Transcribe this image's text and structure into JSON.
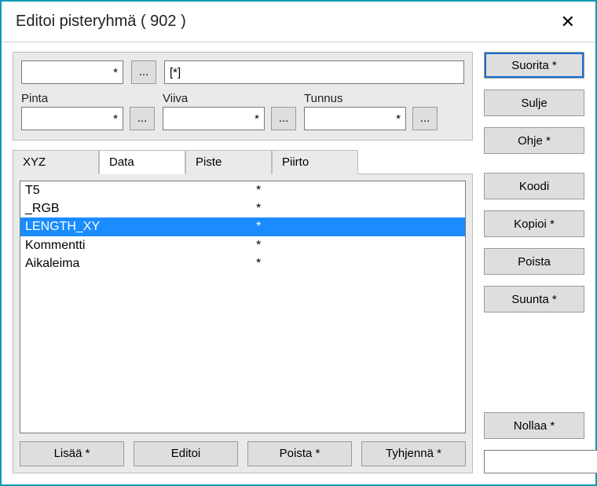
{
  "title": "Editoi pisteryhmä  ( 902 )",
  "top": {
    "field1": {
      "value": "*"
    },
    "browse1": "...",
    "field2": {
      "value": "[*]"
    },
    "pinta": {
      "label": "Pinta",
      "value": "*"
    },
    "browse_pinta": "...",
    "viiva": {
      "label": "Viiva",
      "value": "*"
    },
    "browse_viiva": "...",
    "tunnus": {
      "label": "Tunnus",
      "value": "*"
    },
    "browse_tunnus": "..."
  },
  "tabs": {
    "xyz": "XYZ",
    "data": "Data",
    "piste": "Piste",
    "piirto": "Piirto",
    "active": "data"
  },
  "list": [
    {
      "name": "T5",
      "value": "*",
      "selected": false
    },
    {
      "name": "_RGB",
      "value": "*",
      "selected": false
    },
    {
      "name": "LENGTH_XY",
      "value": "*",
      "selected": true
    },
    {
      "name": "Kommentti",
      "value": "*",
      "selected": false
    },
    {
      "name": "Aikaleima",
      "value": "*",
      "selected": false
    }
  ],
  "bottom": {
    "lisaa": "Lisää *",
    "editoi": "Editoi",
    "poista": "Poista *",
    "tyhjenna": "Tyhjennä *"
  },
  "side": {
    "suorita": "Suorita *",
    "sulje": "Sulje",
    "ohje": "Ohje *",
    "koodi": "Koodi",
    "kopioi": "Kopioi *",
    "poista": "Poista",
    "suunta": "Suunta *",
    "nollaa": "Nollaa *",
    "textval": "",
    "x": "X"
  }
}
